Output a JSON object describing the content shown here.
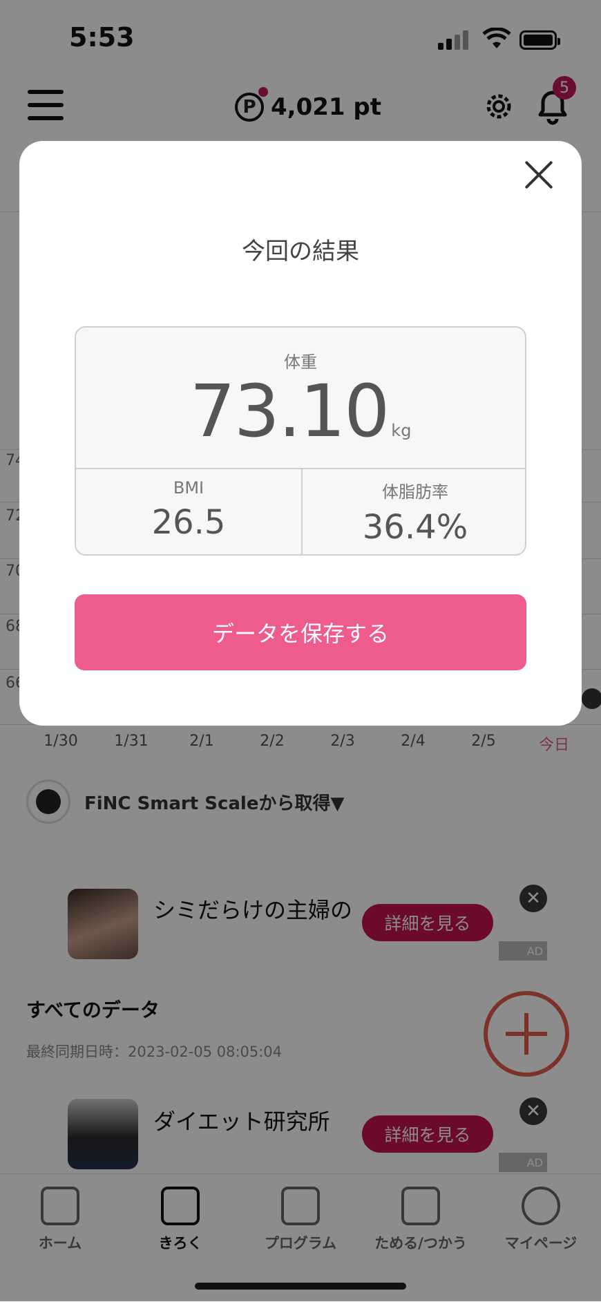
{
  "status_bar": {
    "time": "5:53"
  },
  "header": {
    "points": "4,021",
    "points_unit": "pt",
    "notification_count": "5"
  },
  "chart": {
    "y_labels": [
      "74",
      "72",
      "70",
      "68",
      "66"
    ],
    "x_labels": [
      "1/30",
      "1/31",
      "2/1",
      "2/2",
      "2/3",
      "2/4",
      "2/5",
      "今日"
    ]
  },
  "source": {
    "label": "FiNC Smart Scaleから取得▼"
  },
  "ads": [
    {
      "title": "シミだらけの主婦の",
      "button": "詳細を見る",
      "tag": "AD"
    },
    {
      "title": "ダイエット研究所",
      "button": "詳細を見る",
      "tag": "AD"
    }
  ],
  "all_data": {
    "title": "すべてのデータ",
    "sync": "最終同期日時：2023-02-05 08:05:04"
  },
  "tabs": [
    {
      "label": "ホーム",
      "active": false
    },
    {
      "label": "きろく",
      "active": true
    },
    {
      "label": "プログラム",
      "active": false
    },
    {
      "label": "ためる/つかう",
      "active": false
    },
    {
      "label": "マイページ",
      "active": false
    }
  ],
  "modal": {
    "title": "今回の結果",
    "weight_label": "体重",
    "weight_value": "73.10",
    "weight_unit": "kg",
    "bmi_label": "BMI",
    "bmi_value": "26.5",
    "fat_label": "体脂肪率",
    "fat_value": "36.4%",
    "save_button": "データを保存する"
  }
}
